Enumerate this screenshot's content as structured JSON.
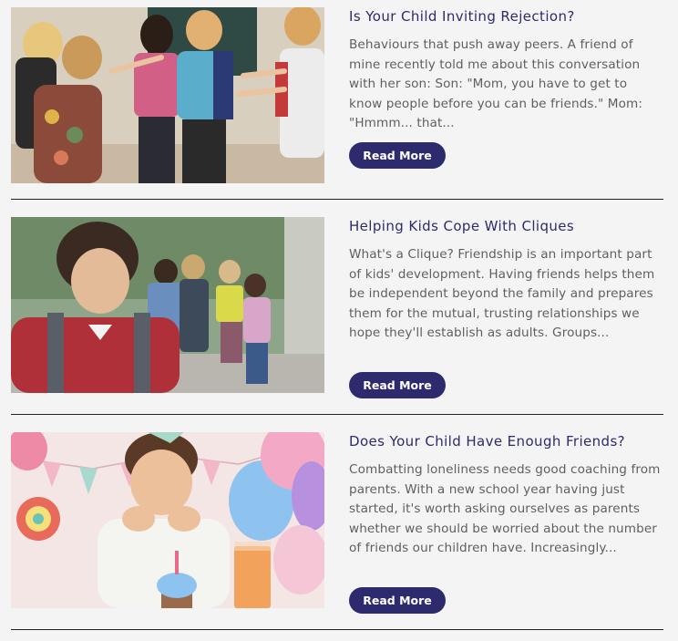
{
  "articles": [
    {
      "title": "Is Your Child Inviting Rejection?",
      "excerpt": "Behaviours that push away peers. A friend of mine recently told me about this conversation with her son: Son: \"Mom, you have to get to know people before you can be friends.\" Mom: \"Hmmm... that...",
      "button_label": "Read More",
      "image": "children-pointing-at-boy-photo"
    },
    {
      "title": "Helping Kids Cope With Cliques",
      "excerpt": "What's a Clique? Friendship is an important part of kids' development. Having friends helps them be independent beyond the family and prepares them for the mutual, trusting relationships we hope they'll establish as adults. Groups...",
      "button_label": "Read More",
      "image": "sad-boy-with-group-behind-photo"
    },
    {
      "title": "Does Your Child Have Enough Friends?",
      "excerpt": "Combatting loneliness needs good coaching from parents. With a new school year having just started, it's worth asking ourselves as parents whether we should be worried about the number of friends our children have. Increasingly...",
      "button_label": "Read More",
      "image": "lonely-boy-at-birthday-party-photo"
    }
  ],
  "colors": {
    "accent": "#2e2a6e",
    "body_text": "#5f5f5f",
    "background": "#f4f4f4"
  }
}
